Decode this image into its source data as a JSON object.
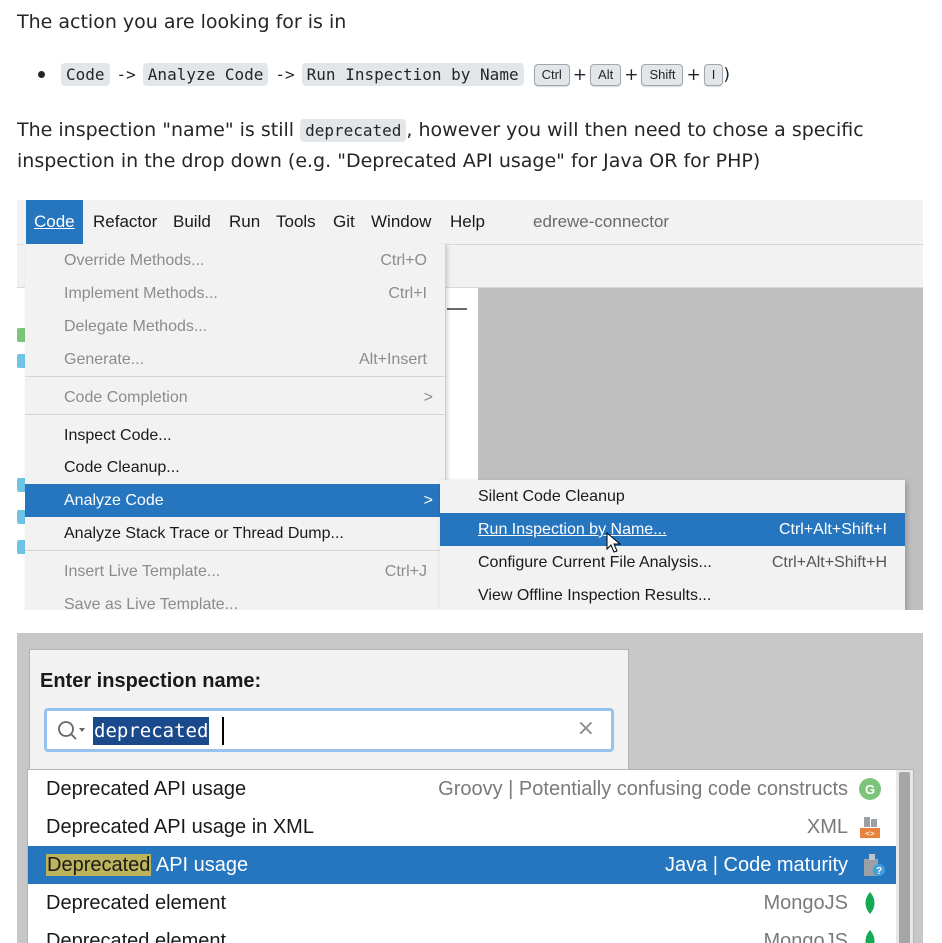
{
  "intro": "The action you are looking for is in",
  "bullet": {
    "code1": "Code",
    "arrow": "->",
    "code2": "Analyze Code",
    "code3": "Run Inspection by Name",
    "keys": [
      "Ctrl",
      "Alt",
      "Shift",
      "I"
    ],
    "plus": "+",
    "close_paren": ")"
  },
  "para2": {
    "before": "The inspection \"name\" is still ",
    "code": "deprecated",
    "after": ", however you will then need to chose a specific inspection in the drop down (e.g. \"Deprecated API usage\" for Java OR for PHP)"
  },
  "ide": {
    "menubar": [
      "Code",
      "Refactor",
      "Build",
      "Run",
      "Tools",
      "Git",
      "Window",
      "Help"
    ],
    "project": "edrewe-connector",
    "menu_items": [
      {
        "label": "Override Methods...",
        "shortcut": "Ctrl+O"
      },
      {
        "label": "Implement Methods...",
        "shortcut": "Ctrl+I"
      },
      {
        "label": "Delegate Methods...",
        "shortcut": ""
      },
      {
        "label": "Generate...",
        "shortcut": "Alt+Insert"
      },
      {
        "label": "Code Completion",
        "shortcut": ""
      },
      {
        "label": "Inspect Code...",
        "shortcut": ""
      },
      {
        "label": "Code Cleanup...",
        "shortcut": ""
      },
      {
        "label": "Analyze Code",
        "shortcut": ""
      },
      {
        "label": "Analyze Stack Trace or Thread Dump...",
        "shortcut": ""
      },
      {
        "label": "Insert Live Template...",
        "shortcut": "Ctrl+J"
      },
      {
        "label": "Save as Live Template...",
        "shortcut": ""
      }
    ],
    "submenu_items": [
      {
        "label": "Silent Code Cleanup",
        "shortcut": ""
      },
      {
        "label": "Run Inspection by Name...",
        "shortcut": "Ctrl+Alt+Shift+I"
      },
      {
        "label": "Configure Current File Analysis...",
        "shortcut": "Ctrl+Alt+Shift+H"
      },
      {
        "label": "View Offline Inspection Results...",
        "shortcut": ""
      }
    ],
    "chevron": ">"
  },
  "dialog": {
    "title": "Enter inspection name:",
    "search_value": "deprecated",
    "clear_icon": "×",
    "results": [
      {
        "name": "Deprecated API usage",
        "category": "Groovy | Potentially confusing code constructs",
        "icon": "groovy-icon"
      },
      {
        "name": "Deprecated API usage in XML",
        "category": "XML",
        "icon": "xml-icon"
      },
      {
        "name_highlight": "Deprecated",
        "name_rest": " API usage",
        "category": "Java | Code maturity",
        "icon": "java-inspection-icon"
      },
      {
        "name": "Deprecated element",
        "category": "MongoJS",
        "icon": "mongodb-leaf-icon"
      },
      {
        "name": "Deprecated element",
        "category": "MongoJS",
        "icon": "mongodb-leaf-icon"
      }
    ]
  },
  "colors": {
    "menu_selection": "#2675bf",
    "search_border": "#97c3f0",
    "highlight": "#bcb35a"
  }
}
